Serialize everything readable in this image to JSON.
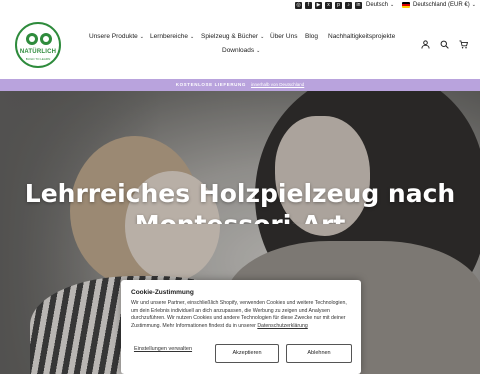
{
  "utility": {
    "social_icons": [
      "instagram-icon",
      "facebook-icon",
      "youtube-icon",
      "x-icon",
      "pinterest-icon",
      "tiktok-icon",
      "linkedin-icon"
    ],
    "language": "Deutsch",
    "country": "Deutschland (EUR €)"
  },
  "logo": {
    "brand": "NATÜRLICH",
    "tagline": "BUILD TO LEARN",
    "color": "#2e8b3c"
  },
  "nav": {
    "items": [
      {
        "label": "Unsere Produkte",
        "dropdown": true
      },
      {
        "label": "Lernbereiche",
        "dropdown": true
      },
      {
        "label": "Spielzeug & Bücher",
        "dropdown": true
      },
      {
        "label": "Über Uns",
        "dropdown": false
      },
      {
        "label": "Blog",
        "dropdown": false
      },
      {
        "label": "Nachhaltigkeitsprojekte",
        "dropdown": false
      },
      {
        "label": "Downloads",
        "dropdown": true
      }
    ],
    "header_icons": [
      "user-icon",
      "search-icon",
      "cart-icon"
    ]
  },
  "announcement": {
    "strong": "KOSTENLOSE LIEFERUNG",
    "link": "innerhalb von Deutschland",
    "background": "#b9a3dd"
  },
  "hero": {
    "title": "Lehrreiches Holzpielzeug nach Montessori-Art"
  },
  "cookie": {
    "title": "Cookie-Zustimmung",
    "text": "Wir und unsere Partner, einschließlich Shopify, verwenden Cookies und weitere Technologien, um dein Erlebnis individuell an dich anzupassen, die Werbung zu zeigen und Analysen durchzuführen. Wir nutzen Cookies und andere Technologien für diese Zwecke nur mit deiner Zustimmung. Mehr Informationen findest du in unserer",
    "policy_link": "Datenschutzerklärung",
    "settings_label": "Einstellungen verwalten",
    "accept_label": "Akzeptieren",
    "reject_label": "Ablehnen"
  }
}
